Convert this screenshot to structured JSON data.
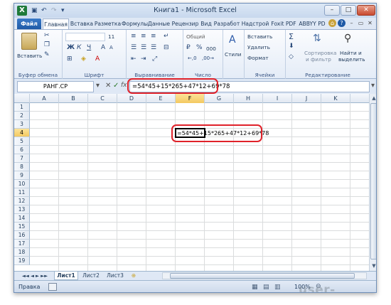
{
  "window": {
    "title": "Книга1 - Microsoft Excel",
    "app_icon": "X",
    "qat_undo": "↶",
    "qat_redo": "↷",
    "min": "–",
    "max": "□",
    "close": "✕"
  },
  "tabs": {
    "file": "Файл",
    "items": [
      "Главная",
      "Вставка",
      "Разметка",
      "Формулы",
      "Данные",
      "Рецензир",
      "Вид",
      "Разработ",
      "Надстрой",
      "Foxit PDF",
      "ABBYY PD"
    ]
  },
  "ribbon": {
    "clipboard": {
      "paste": "Вставить",
      "label": "Буфер обмена"
    },
    "font": {
      "size": "11",
      "bold": "Ж",
      "italic": "К",
      "underline": "Ч",
      "grow": "A",
      "shrink": "A",
      "fontcolor": "A",
      "label": "Шрифт"
    },
    "alignment": {
      "label": "Выравнивание"
    },
    "number": {
      "format": "Общий",
      "percent": "%",
      "thousands": "000",
      "label": "Число"
    },
    "styles": {
      "label": "Стили"
    },
    "cells": {
      "insert": "Вставить",
      "delete": "Удалить",
      "format": "Формат",
      "label": "Ячейки"
    },
    "editing": {
      "sum": "Σ",
      "sort": "Сортировка",
      "sort2": "и фильтр",
      "find": "Найти и",
      "find2": "выделить",
      "label": "Редактирование"
    }
  },
  "formula_bar": {
    "name_box": "РАНГ.СР",
    "cancel": "✕",
    "enter": "✓",
    "fx": "fx",
    "formula": "=54*45+15*265+47*12+69*78"
  },
  "grid": {
    "columns": [
      "A",
      "B",
      "C",
      "D",
      "E",
      "F",
      "G",
      "H",
      "I",
      "J",
      "K"
    ],
    "rows": [
      "1",
      "2",
      "3",
      "4",
      "5",
      "6",
      "7",
      "8",
      "9",
      "10",
      "11",
      "12",
      "13",
      "14",
      "15",
      "16",
      "17",
      "18",
      "19"
    ],
    "active_cell": "F4",
    "active_cell_text": "=54*45+15*265+47*12+69*78"
  },
  "sheets": {
    "nav": "◄◄ ◄ ► ►►",
    "items": [
      "Лист1",
      "Лист2",
      "Лист3"
    ],
    "new_sheet": "⊕"
  },
  "status": {
    "mode": "Правка",
    "zoom": "100%"
  },
  "watermark": "user-life.com",
  "colors": {
    "highlight": "#e0222a",
    "file_tab": "#1f5aa6",
    "excel_green": "#1f7a3a"
  }
}
